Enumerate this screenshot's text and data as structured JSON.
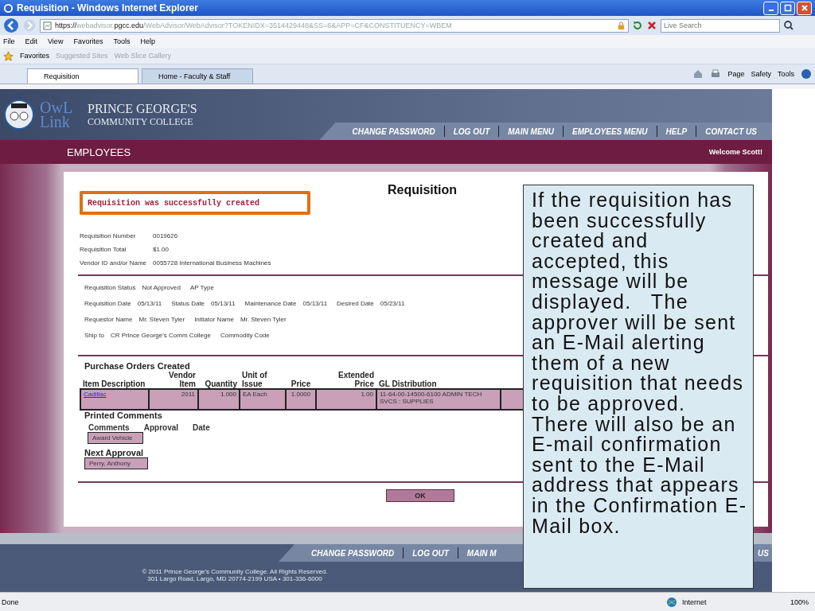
{
  "window": {
    "title": "Requisition - Windows Internet Explorer"
  },
  "address_bar": {
    "scheme": "https://",
    "host_dim": "webadvisor.",
    "host": "pgcc.edu",
    "path": "/WebAdvisor/WebAdvisor?TOKENIDX=3514429448&SS=6&APP=CF&CONSTITUENCY=WBEM"
  },
  "search": {
    "placeholder": "Live Search"
  },
  "menu": [
    "File",
    "Edit",
    "View",
    "Favorites",
    "Tools",
    "Help"
  ],
  "favorites_bar": {
    "label": "Favorites",
    "links": [
      {
        "label": "Suggested Sites",
        "disabled": true
      },
      {
        "label": "Web Slice Gallery",
        "disabled": true
      }
    ]
  },
  "tabs": [
    {
      "label": "Requisition",
      "selected": true
    },
    {
      "label": "Home - Faculty & Staff",
      "selected": false
    }
  ],
  "command_bar": [
    "Page",
    "Safety",
    "Tools"
  ],
  "site": {
    "logo_text": "OwL Link",
    "college": [
      "PRINCE GEORGE'S",
      "COMMUNITY COLLEGE"
    ],
    "nav": [
      "CHANGE PASSWORD",
      "LOG OUT",
      "MAIN MENU",
      "EMPLOYEES MENU",
      "HELP",
      "CONTACT US"
    ],
    "section": "EMPLOYEES",
    "welcome": "Welcome Scott!"
  },
  "requisition": {
    "title": "Requisition",
    "message": "Requisition was successfully created",
    "fields": [
      {
        "label": "Requisition Number",
        "value": "0019626"
      },
      {
        "label": "Requisition Total",
        "value": "$1.00"
      },
      {
        "label": "Vendor ID and/or Name",
        "value": "0055728 International Business Machines"
      }
    ],
    "status_rows": [
      [
        {
          "label": "Requisition Status",
          "value": "Not Approved"
        },
        {
          "label": "AP Type"
        }
      ],
      [
        {
          "label": "Requisition Date",
          "value": "05/13/11"
        },
        {
          "label": "Status Date",
          "value": "05/13/11"
        },
        {
          "label": "Maintenance Date",
          "value": "05/13/11"
        },
        {
          "label": "Desired Date",
          "value": "05/23/11"
        }
      ],
      [
        {
          "label": "Requestor Name",
          "value": "Mr. Steven Tyler"
        },
        {
          "label": "Initiator Name",
          "value": "Mr. Steven Tyler"
        }
      ],
      [
        {
          "label": "Ship to",
          "value": "CR Prince George's Comm College"
        },
        {
          "label": "Commodity Code"
        }
      ]
    ],
    "orders_title": "Purchase Orders Created",
    "table": {
      "columns": [
        "Item Description",
        "Vendor Item",
        "Quantity",
        "Unit of Issue",
        "Price",
        "Extended Price",
        "GL Distribution"
      ],
      "rows": [
        [
          "Cadillac",
          "2011",
          "1.000",
          "EA Each",
          "1.0000",
          "1.00",
          "11-64-00-14500-6100 ADMIN TECH SVCS : SUPPLIES"
        ]
      ]
    },
    "comments_title": "Printed Comments",
    "comment_columns": [
      "Comments",
      "Approval",
      "Date"
    ],
    "comments": [
      "Award Vehicle"
    ],
    "next_approval_title": "Next Approval",
    "next_approval": "Perry, Anthony",
    "ok": "OK"
  },
  "footer": {
    "nav": [
      "CHANGE PASSWORD",
      "LOG OUT",
      "MAIN M",
      "US"
    ],
    "copyright": "© 2011 Prince George's Community College. All Rights Reserved.",
    "address": "301 Largo Road, Largo, MD 20774-2199 USA • 301-336-6000"
  },
  "callout": "If the requisition has been successfully created and accepted, this message will be displayed.   The approver will be sent an E-Mail alerting them of a new requisition that needs to be approved. There will also be an E-mail confirmation sent to the E-Mail address that appears in the Confirmation E-Mail box.",
  "status_bar": {
    "text": "Done",
    "zone": "Internet",
    "zoom": "100%"
  }
}
